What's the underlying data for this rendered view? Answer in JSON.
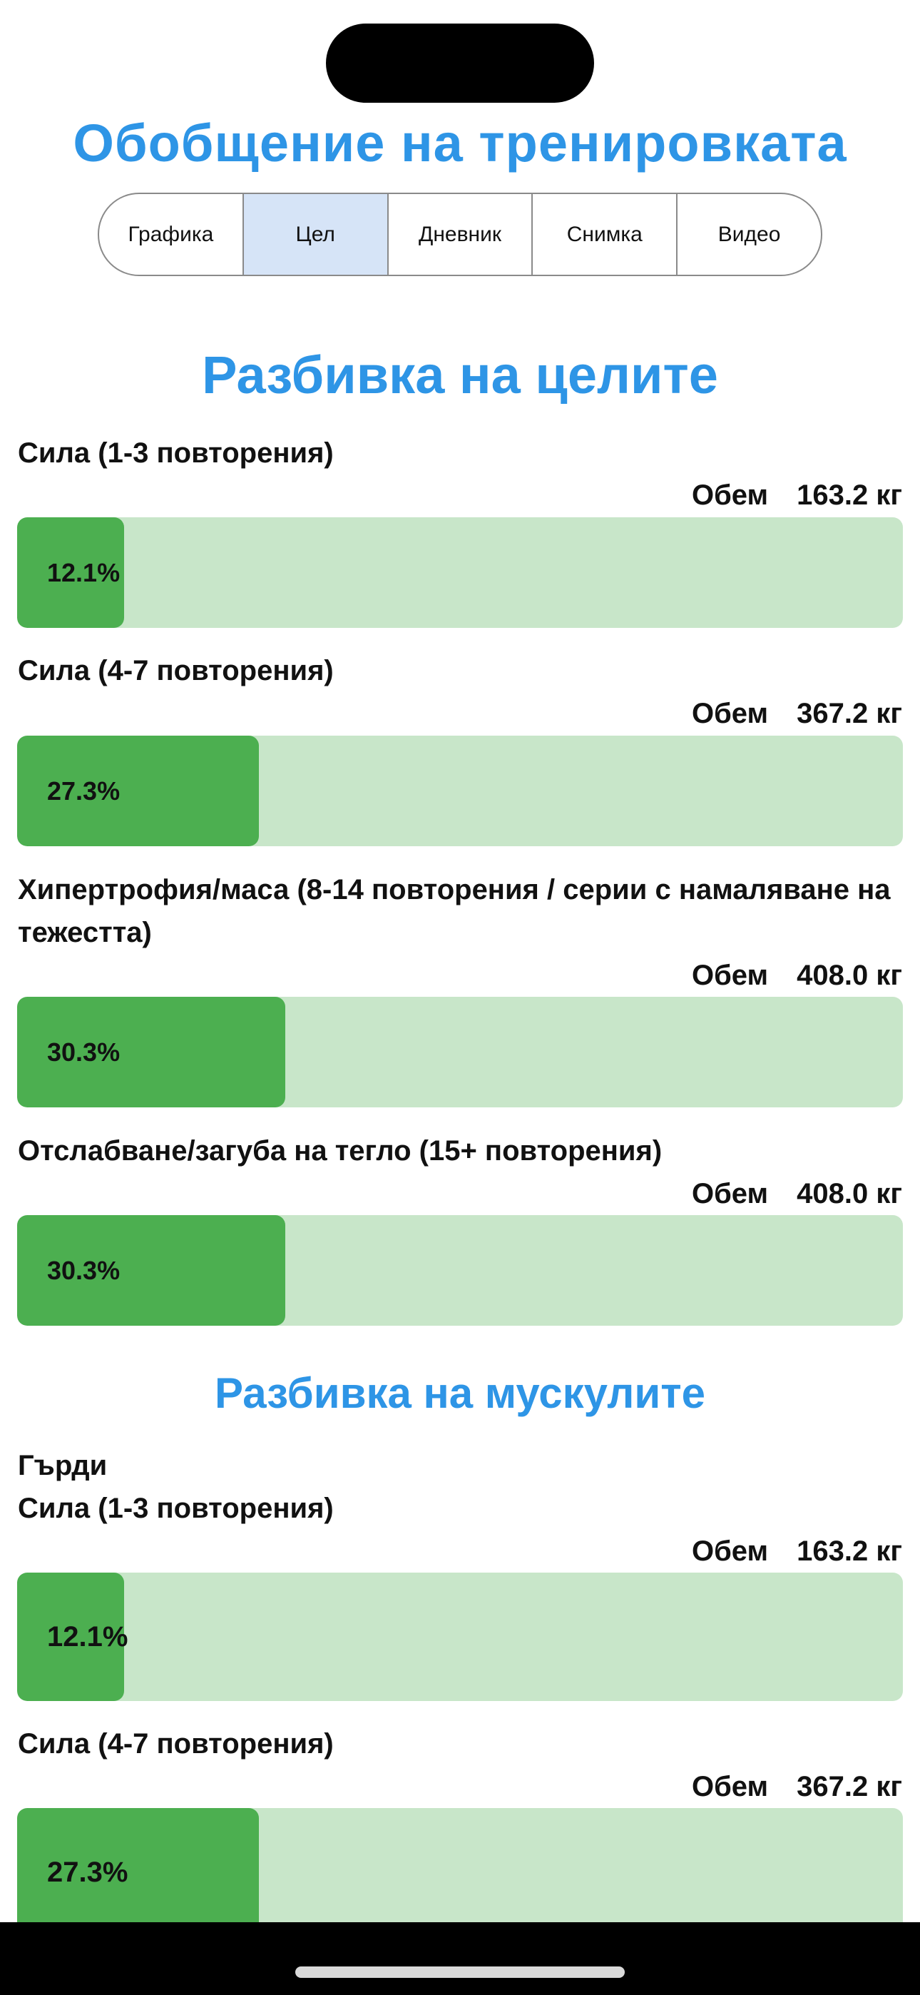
{
  "header": {
    "title": "Обобщение на тренировката"
  },
  "tabs": [
    {
      "label": "Графика",
      "selected": false
    },
    {
      "label": "Цел",
      "selected": true
    },
    {
      "label": "Дневник",
      "selected": false
    },
    {
      "label": "Снимка",
      "selected": false
    },
    {
      "label": "Видео",
      "selected": false
    }
  ],
  "goals": {
    "title": "Разбивка на целите",
    "items": [
      {
        "label": "Сила (1-3 повторения)",
        "volume_label": "Обем",
        "volume_value": "163.2 кг",
        "percent_text": "12.1%",
        "percent": 12.1
      },
      {
        "label": "Сила (4-7 повторения)",
        "volume_label": "Обем",
        "volume_value": "367.2 кг",
        "percent_text": "27.3%",
        "percent": 27.3
      },
      {
        "label": "Хипертрофия/маса (8-14 повторения / серии с намаляване на тежестта)",
        "volume_label": "Обем",
        "volume_value": "408.0 кг",
        "percent_text": "30.3%",
        "percent": 30.3
      },
      {
        "label": "Отслабване/загуба на тегло (15+ повторения)",
        "volume_label": "Обем",
        "volume_value": "408.0 кг",
        "percent_text": "30.3%",
        "percent": 30.3
      }
    ]
  },
  "muscles": {
    "title": "Разбивка на мускулите",
    "group_name": "Гърди",
    "items": [
      {
        "label": "Сила (1-3 повторения)",
        "volume_label": "Обем",
        "volume_value": "163.2 кг",
        "percent_text": "12.1%",
        "percent": 12.1
      },
      {
        "label": "Сила (4-7 повторения)",
        "volume_label": "Обем",
        "volume_value": "367.2 кг",
        "percent_text": "27.3%",
        "percent": 27.3
      }
    ]
  },
  "colors": {
    "accent": "#2e95e6",
    "bar_fill": "#4caf50",
    "bar_track": "#c8e6c9",
    "tab_selected": "#d6e4f7"
  }
}
